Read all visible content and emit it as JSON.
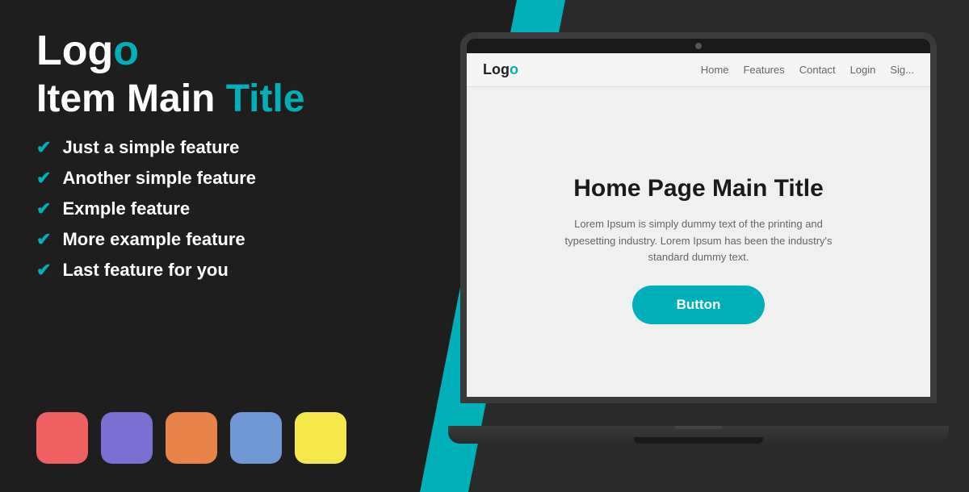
{
  "left": {
    "logo": {
      "text_plain": "Logo",
      "text_teal": "o",
      "display": "Log"
    },
    "logo_display": "Logo",
    "main_title_plain": "Item Main ",
    "main_title_teal": "Title",
    "features": [
      {
        "id": 1,
        "text": "Just a simple feature"
      },
      {
        "id": 2,
        "text": "Another simple feature"
      },
      {
        "id": 3,
        "text": "Exmple feature"
      },
      {
        "id": 4,
        "text": "More example feature"
      },
      {
        "id": 5,
        "text": "Last feature for you"
      }
    ],
    "swatches": [
      {
        "id": 1,
        "color": "#f06060",
        "name": "coral-swatch"
      },
      {
        "id": 2,
        "color": "#7b6fd4",
        "name": "purple-swatch"
      },
      {
        "id": 3,
        "color": "#e8834a",
        "name": "orange-swatch"
      },
      {
        "id": 4,
        "color": "#7098d4",
        "name": "blue-swatch"
      },
      {
        "id": 5,
        "color": "#f5e84a",
        "name": "yellow-swatch"
      }
    ]
  },
  "right": {
    "browser": {
      "logo_plain": "Log",
      "logo_teal": "o",
      "logo_full": "Logo",
      "nav_items": [
        "Home",
        "Features",
        "Contact",
        "Login",
        "Sig..."
      ]
    },
    "hero": {
      "title": "Home Page Main Title",
      "body": "Lorem Ipsum is simply dummy text of the printing and typesetting industry. Lorem Ipsum has been the industry's standard dummy text.",
      "button_label": "Button"
    }
  },
  "colors": {
    "teal": "#00b0b9",
    "dark_bg": "#1e1e1e",
    "white": "#ffffff"
  }
}
